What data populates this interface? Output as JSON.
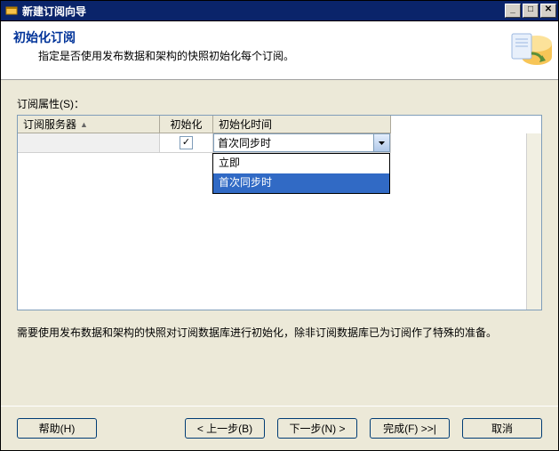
{
  "window": {
    "title": "新建订阅向导"
  },
  "header": {
    "title": "初始化订阅",
    "subtitle": "指定是否使用发布数据和架构的快照初始化每个订阅。"
  },
  "properties_label": "订阅属性(S)：",
  "grid": {
    "columns": {
      "server": "订阅服务器",
      "init": "初始化",
      "time": "初始化时间"
    },
    "row": {
      "server": " ",
      "init_checked": "✓",
      "time_selected": "首次同步时"
    },
    "dropdown": {
      "options": [
        "立即",
        "首次同步时"
      ],
      "selected_index": 1
    }
  },
  "note": "需要使用发布数据和架构的快照对订阅数据库进行初始化，除非订阅数据库已为订阅作了特殊的准备。",
  "buttons": {
    "help": "帮助(H)",
    "back": "< 上一步(B)",
    "next": "下一步(N) >",
    "finish": "完成(F) >>|",
    "cancel": "取消"
  }
}
